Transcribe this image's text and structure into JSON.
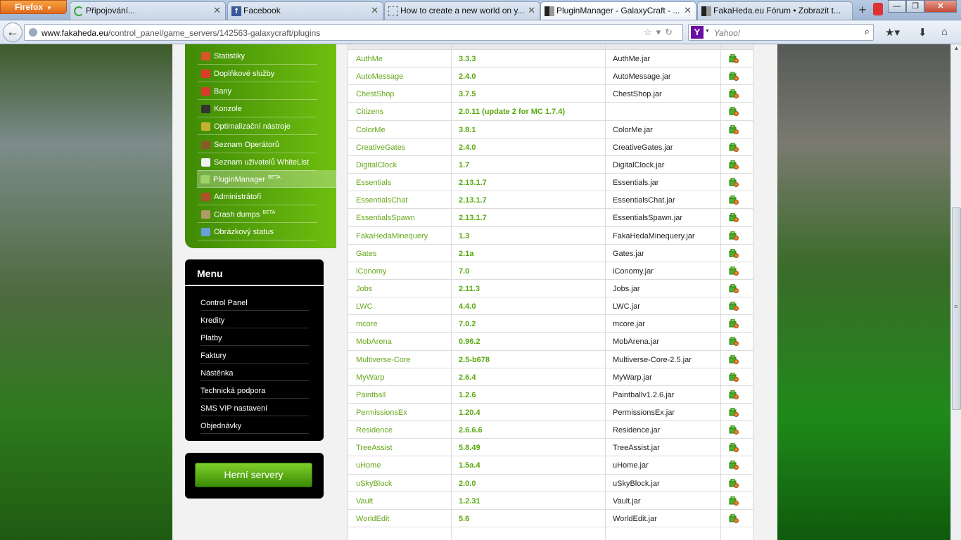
{
  "browser": {
    "app_button": "Firefox",
    "tabs": [
      {
        "label": "Připojování...",
        "icon": "loading-icon"
      },
      {
        "label": "Facebook",
        "icon": "facebook-icon"
      },
      {
        "label": "How to create a new world on y...",
        "icon": "blank-page-icon"
      },
      {
        "label": "PluginManager - GalaxyCraft - ...",
        "icon": "fakaheda-icon",
        "active": true
      },
      {
        "label": "FakaHeda.eu Fórum • Zobrazit t...",
        "icon": "fakaheda-icon"
      }
    ],
    "url_domain": "www.fakaheda.eu",
    "url_path": "/control_panel/game_servers/142563-galaxycraft/plugins",
    "search_placeholder": "Yahoo!",
    "search_logo": "Y"
  },
  "panel_menu": {
    "items": [
      {
        "label": "Statistiky",
        "icon": "stats-icon",
        "color": "#d8552b"
      },
      {
        "label": "Doplňkové služby",
        "icon": "gift-icon",
        "color": "#e03a2a"
      },
      {
        "label": "Bany",
        "icon": "ban-icon",
        "color": "#d63b2b"
      },
      {
        "label": "Konzole",
        "icon": "console-icon",
        "color": "#333333"
      },
      {
        "label": "Optimalizační nástroje",
        "icon": "wand-icon",
        "color": "#c8b030"
      },
      {
        "label": "Seznam Operátorů",
        "icon": "operator-icon",
        "color": "#8a5a2a"
      },
      {
        "label": "Seznam uživatelů WhiteList",
        "icon": "list-icon",
        "color": "#f2f2f2"
      },
      {
        "label": "PluginManager",
        "icon": "plugin-icon",
        "color": "#9ed36a",
        "badge": "BETA",
        "active": true
      },
      {
        "label": "Administrátoři",
        "icon": "admin-icon",
        "color": "#b0502a"
      },
      {
        "label": "Crash dumps",
        "icon": "gear-icon",
        "color": "#b09a6a",
        "badge": "BETA"
      },
      {
        "label": "Obrázkový status",
        "icon": "image-icon",
        "color": "#6aa0d8"
      }
    ]
  },
  "main_menu": {
    "title": "Menu",
    "items": [
      "Control Panel",
      "Kredity",
      "Platby",
      "Faktury",
      "Nástěnka",
      "Technická podpora",
      "SMS VIP nastavení",
      "Objednávky"
    ]
  },
  "game_servers_button": "Herní servery",
  "plugins": [
    {
      "name": "AuthMe",
      "version": "3.3.3",
      "file": "AuthMe.jar"
    },
    {
      "name": "AutoMessage",
      "version": "2.4.0",
      "file": "AutoMessage.jar"
    },
    {
      "name": "ChestShop",
      "version": "3.7.5",
      "file": "ChestShop.jar"
    },
    {
      "name": "Citizens",
      "version": "2.0.11 (update 2 for MC 1.7.4)",
      "file": ""
    },
    {
      "name": "ColorMe",
      "version": "3.8.1",
      "file": "ColorMe.jar"
    },
    {
      "name": "CreativeGates",
      "version": "2.4.0",
      "file": "CreativeGates.jar"
    },
    {
      "name": "DigitalClock",
      "version": "1.7",
      "file": "DigitalClock.jar"
    },
    {
      "name": "Essentials",
      "version": "2.13.1.7",
      "file": "Essentials.jar"
    },
    {
      "name": "EssentialsChat",
      "version": "2.13.1.7",
      "file": "EssentialsChat.jar"
    },
    {
      "name": "EssentialsSpawn",
      "version": "2.13.1.7",
      "file": "EssentialsSpawn.jar"
    },
    {
      "name": "FakaHedaMinequery",
      "version": "1.3",
      "file": "FakaHedaMinequery.jar"
    },
    {
      "name": "Gates",
      "version": "2.1a",
      "file": "Gates.jar"
    },
    {
      "name": "iConomy",
      "version": "7.0",
      "file": "iConomy.jar"
    },
    {
      "name": "Jobs",
      "version": "2.11.3",
      "file": "Jobs.jar"
    },
    {
      "name": "LWC",
      "version": "4.4.0",
      "file": "LWC.jar"
    },
    {
      "name": "mcore",
      "version": "7.0.2",
      "file": "mcore.jar"
    },
    {
      "name": "MobArena",
      "version": "0.96.2",
      "file": "MobArena.jar"
    },
    {
      "name": "Multiverse-Core",
      "version": "2.5-b678",
      "file": "Multiverse-Core-2.5.jar"
    },
    {
      "name": "MyWarp",
      "version": "2.6.4",
      "file": "MyWarp.jar"
    },
    {
      "name": "Paintball",
      "version": "1.2.6",
      "file": "Paintballv1.2.6.jar"
    },
    {
      "name": "PermissionsEx",
      "version": "1.20.4",
      "file": "PermissionsEx.jar"
    },
    {
      "name": "Residence",
      "version": "2.6.6.6",
      "file": "Residence.jar"
    },
    {
      "name": "TreeAssist",
      "version": "5.8.49",
      "file": "TreeAssist.jar"
    },
    {
      "name": "uHome",
      "version": "1.5a.4",
      "file": "uHome.jar"
    },
    {
      "name": "uSkyBlock",
      "version": "2.0.0",
      "file": "uSkyBlock.jar"
    },
    {
      "name": "Vault",
      "version": "1.2.31",
      "file": "Vault.jar"
    },
    {
      "name": "WorldEdit",
      "version": "5.6",
      "file": "WorldEdit.jar"
    }
  ]
}
